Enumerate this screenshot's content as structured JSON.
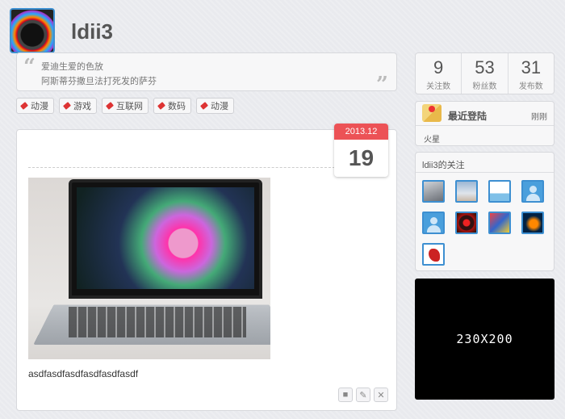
{
  "profile": {
    "username": "ldii3",
    "quote_line1": "爱迪生爱的色放",
    "quote_line2": "阿斯蒂芬撒旦法打死发的萨芬"
  },
  "tags": [
    "动漫",
    "游戏",
    "互联网",
    "数码",
    "动漫"
  ],
  "post": {
    "month": "2013.12",
    "day": "19",
    "caption": "asdfasdfasdfasdfasdfasdf",
    "actions": [
      "comment-icon",
      "edit-icon",
      "close-icon"
    ]
  },
  "stats": [
    {
      "num": "9",
      "label": "关注数"
    },
    {
      "num": "53",
      "label": "粉丝数"
    },
    {
      "num": "31",
      "label": "发布数"
    }
  ],
  "login": {
    "title": "最近登陆",
    "time": "刚刚",
    "location": "火星"
  },
  "following": {
    "title": "ldii3的关注",
    "count": 9
  },
  "ad": {
    "text": "230X200"
  }
}
